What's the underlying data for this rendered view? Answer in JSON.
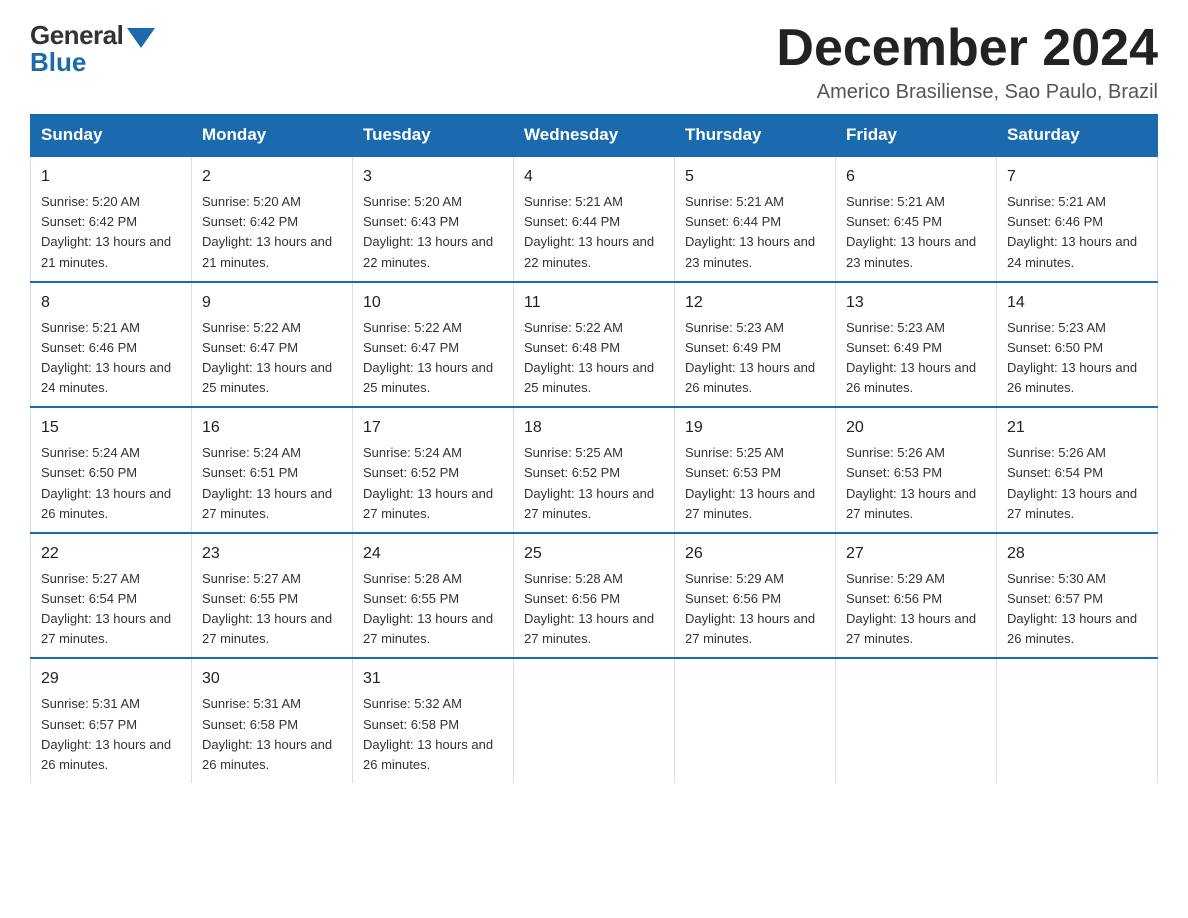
{
  "header": {
    "logo": {
      "general": "General",
      "blue": "Blue"
    },
    "title": "December 2024",
    "subtitle": "Americo Brasiliense, Sao Paulo, Brazil"
  },
  "weekdays": [
    "Sunday",
    "Monday",
    "Tuesday",
    "Wednesday",
    "Thursday",
    "Friday",
    "Saturday"
  ],
  "weeks": [
    [
      {
        "day": "1",
        "sunrise": "5:20 AM",
        "sunset": "6:42 PM",
        "daylight": "13 hours and 21 minutes."
      },
      {
        "day": "2",
        "sunrise": "5:20 AM",
        "sunset": "6:42 PM",
        "daylight": "13 hours and 21 minutes."
      },
      {
        "day": "3",
        "sunrise": "5:20 AM",
        "sunset": "6:43 PM",
        "daylight": "13 hours and 22 minutes."
      },
      {
        "day": "4",
        "sunrise": "5:21 AM",
        "sunset": "6:44 PM",
        "daylight": "13 hours and 22 minutes."
      },
      {
        "day": "5",
        "sunrise": "5:21 AM",
        "sunset": "6:44 PM",
        "daylight": "13 hours and 23 minutes."
      },
      {
        "day": "6",
        "sunrise": "5:21 AM",
        "sunset": "6:45 PM",
        "daylight": "13 hours and 23 minutes."
      },
      {
        "day": "7",
        "sunrise": "5:21 AM",
        "sunset": "6:46 PM",
        "daylight": "13 hours and 24 minutes."
      }
    ],
    [
      {
        "day": "8",
        "sunrise": "5:21 AM",
        "sunset": "6:46 PM",
        "daylight": "13 hours and 24 minutes."
      },
      {
        "day": "9",
        "sunrise": "5:22 AM",
        "sunset": "6:47 PM",
        "daylight": "13 hours and 25 minutes."
      },
      {
        "day": "10",
        "sunrise": "5:22 AM",
        "sunset": "6:47 PM",
        "daylight": "13 hours and 25 minutes."
      },
      {
        "day": "11",
        "sunrise": "5:22 AM",
        "sunset": "6:48 PM",
        "daylight": "13 hours and 25 minutes."
      },
      {
        "day": "12",
        "sunrise": "5:23 AM",
        "sunset": "6:49 PM",
        "daylight": "13 hours and 26 minutes."
      },
      {
        "day": "13",
        "sunrise": "5:23 AM",
        "sunset": "6:49 PM",
        "daylight": "13 hours and 26 minutes."
      },
      {
        "day": "14",
        "sunrise": "5:23 AM",
        "sunset": "6:50 PM",
        "daylight": "13 hours and 26 minutes."
      }
    ],
    [
      {
        "day": "15",
        "sunrise": "5:24 AM",
        "sunset": "6:50 PM",
        "daylight": "13 hours and 26 minutes."
      },
      {
        "day": "16",
        "sunrise": "5:24 AM",
        "sunset": "6:51 PM",
        "daylight": "13 hours and 27 minutes."
      },
      {
        "day": "17",
        "sunrise": "5:24 AM",
        "sunset": "6:52 PM",
        "daylight": "13 hours and 27 minutes."
      },
      {
        "day": "18",
        "sunrise": "5:25 AM",
        "sunset": "6:52 PM",
        "daylight": "13 hours and 27 minutes."
      },
      {
        "day": "19",
        "sunrise": "5:25 AM",
        "sunset": "6:53 PM",
        "daylight": "13 hours and 27 minutes."
      },
      {
        "day": "20",
        "sunrise": "5:26 AM",
        "sunset": "6:53 PM",
        "daylight": "13 hours and 27 minutes."
      },
      {
        "day": "21",
        "sunrise": "5:26 AM",
        "sunset": "6:54 PM",
        "daylight": "13 hours and 27 minutes."
      }
    ],
    [
      {
        "day": "22",
        "sunrise": "5:27 AM",
        "sunset": "6:54 PM",
        "daylight": "13 hours and 27 minutes."
      },
      {
        "day": "23",
        "sunrise": "5:27 AM",
        "sunset": "6:55 PM",
        "daylight": "13 hours and 27 minutes."
      },
      {
        "day": "24",
        "sunrise": "5:28 AM",
        "sunset": "6:55 PM",
        "daylight": "13 hours and 27 minutes."
      },
      {
        "day": "25",
        "sunrise": "5:28 AM",
        "sunset": "6:56 PM",
        "daylight": "13 hours and 27 minutes."
      },
      {
        "day": "26",
        "sunrise": "5:29 AM",
        "sunset": "6:56 PM",
        "daylight": "13 hours and 27 minutes."
      },
      {
        "day": "27",
        "sunrise": "5:29 AM",
        "sunset": "6:56 PM",
        "daylight": "13 hours and 27 minutes."
      },
      {
        "day": "28",
        "sunrise": "5:30 AM",
        "sunset": "6:57 PM",
        "daylight": "13 hours and 26 minutes."
      }
    ],
    [
      {
        "day": "29",
        "sunrise": "5:31 AM",
        "sunset": "6:57 PM",
        "daylight": "13 hours and 26 minutes."
      },
      {
        "day": "30",
        "sunrise": "5:31 AM",
        "sunset": "6:58 PM",
        "daylight": "13 hours and 26 minutes."
      },
      {
        "day": "31",
        "sunrise": "5:32 AM",
        "sunset": "6:58 PM",
        "daylight": "13 hours and 26 minutes."
      },
      null,
      null,
      null,
      null
    ]
  ]
}
